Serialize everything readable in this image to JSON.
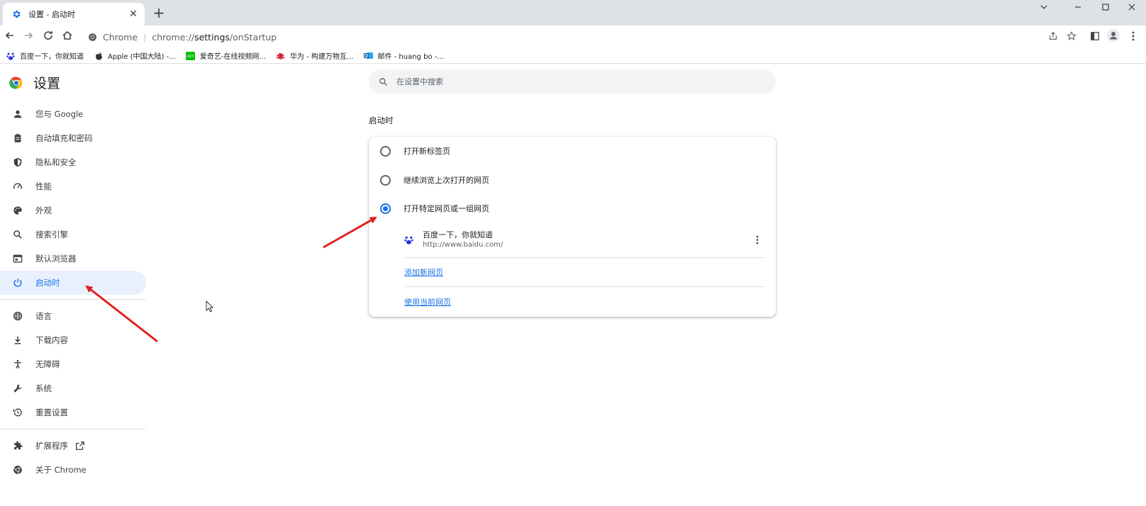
{
  "tab": {
    "title": "设置 - 启动时",
    "close_label": "✕",
    "new_tab_label": "+"
  },
  "address_bar": {
    "site_label": "Chrome",
    "separator": "|",
    "url_scheme": "chrome://",
    "url_host": "settings",
    "url_path": "/onStartup"
  },
  "bookmarks": [
    {
      "label": "百度一下，你就知道",
      "icon": "baidu-icon"
    },
    {
      "label": "Apple (中国大陆) -...",
      "icon": "apple-icon"
    },
    {
      "label": "爱奇艺-在线视频网...",
      "icon": "iqiyi-icon"
    },
    {
      "label": "华为 - 构建万物互...",
      "icon": "huawei-icon"
    },
    {
      "label": "邮件 - huang bo -...",
      "icon": "outlook-icon"
    }
  ],
  "sidebar": {
    "title": "设置",
    "items": [
      {
        "label": "您与 Google",
        "icon": "person-icon"
      },
      {
        "label": "自动填充和密码",
        "icon": "clipboard-icon"
      },
      {
        "label": "隐私和安全",
        "icon": "shield-icon"
      },
      {
        "label": "性能",
        "icon": "speedometer-icon"
      },
      {
        "label": "外观",
        "icon": "palette-icon"
      },
      {
        "label": "搜索引擎",
        "icon": "search-icon"
      },
      {
        "label": "默认浏览器",
        "icon": "browser-icon"
      },
      {
        "label": "启动时",
        "icon": "power-icon",
        "active": true
      }
    ],
    "items2": [
      {
        "label": "语言",
        "icon": "globe-icon"
      },
      {
        "label": "下载内容",
        "icon": "download-icon"
      },
      {
        "label": "无障碍",
        "icon": "accessibility-icon"
      },
      {
        "label": "系统",
        "icon": "wrench-icon"
      },
      {
        "label": "重置设置",
        "icon": "history-icon"
      }
    ],
    "items3": [
      {
        "label": "扩展程序",
        "icon": "puzzle-icon"
      },
      {
        "label": "关于 Chrome",
        "icon": "chrome-icon"
      }
    ]
  },
  "search": {
    "placeholder": "在设置中搜索"
  },
  "startup": {
    "section_title": "启动时",
    "options": [
      {
        "label": "打开新标签页",
        "checked": false
      },
      {
        "label": "继续浏览上次打开的网页",
        "checked": false
      },
      {
        "label": "打开特定网页或一组网页",
        "checked": true
      }
    ],
    "pages": [
      {
        "title": "百度一下，你就知道",
        "url": "http://www.baidu.com/"
      }
    ],
    "add_page_label": "添加新网页",
    "use_current_label": "使用当前网页"
  },
  "colors": {
    "accent": "#1a73e8",
    "active_bg": "#e8f0fe",
    "arrow": "#e02020"
  }
}
